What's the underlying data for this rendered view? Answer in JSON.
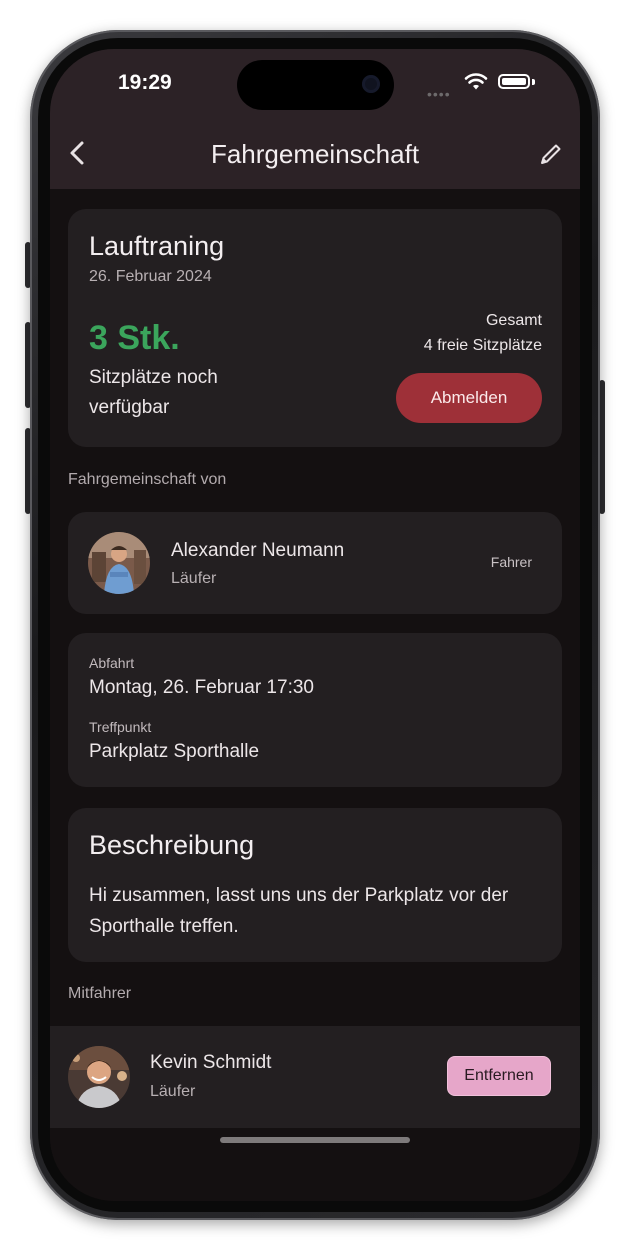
{
  "status_bar": {
    "time": "19:29"
  },
  "nav": {
    "title": "Fahrgemeinschaft"
  },
  "event": {
    "title": "Lauftraning",
    "date": "26. Februar 2024",
    "seats_available": "3 Stk.",
    "seats_available_label": "Sitzplätze noch verfügbar",
    "total_label": "Gesamt",
    "total_value": "4 freie Sitzplätze",
    "unsubscribe_label": "Abmelden"
  },
  "driver_section": {
    "label": "Fahrgemeinschaft von",
    "name": "Alexander Neumann",
    "role": "Läufer",
    "badge": "Fahrer"
  },
  "departure": {
    "label": "Abfahrt",
    "value": "Montag, 26. Februar 17:30",
    "meeting_label": "Treffpunkt",
    "meeting_value": "Parkplatz Sporthalle"
  },
  "description": {
    "title": "Beschreibung",
    "text": "Hi zusammen, lasst uns uns der Parkplatz vor der Sporthalle treffen."
  },
  "passengers": {
    "label": "Mitfahrer",
    "items": [
      {
        "name": "Kevin Schmidt",
        "role": "Läufer",
        "action": "Entfernen"
      }
    ]
  },
  "icons": {
    "back": "chevron-left-icon",
    "edit": "pencil-icon",
    "wifi": "wifi-icon",
    "battery": "battery-icon"
  },
  "colors": {
    "accent_green": "#3ba55c",
    "danger": "#9e3038",
    "pink_button": "#e6a6c9",
    "card": "#231f21",
    "background": "#141011"
  }
}
